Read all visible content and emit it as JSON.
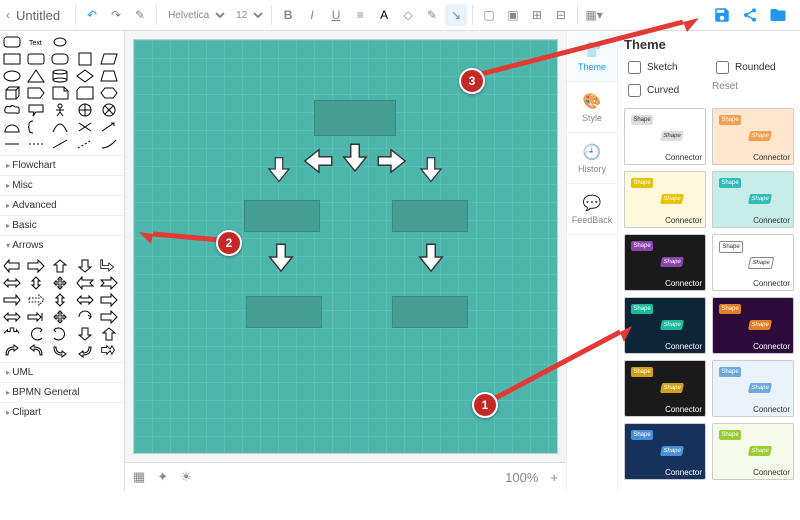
{
  "header": {
    "doc_title": "Untitled",
    "font_family": "Helvetica",
    "font_size": "12",
    "zoom": "100%"
  },
  "toolbar": {
    "undo": "↶",
    "redo": "↷",
    "paint": "⌂",
    "bold": "B",
    "italic": "I",
    "underline": "U",
    "save": "💾",
    "share": "⠪",
    "folder": "📁"
  },
  "left_panel": {
    "categories": [
      "Flowchart",
      "Misc",
      "Advanced",
      "Basic",
      "Arrows",
      "UML",
      "BPMN General",
      "Clipart"
    ]
  },
  "sidetabs": {
    "items": [
      {
        "label": "Theme",
        "icon": "👕"
      },
      {
        "label": "Style",
        "icon": "🎨"
      },
      {
        "label": "History",
        "icon": "🕘"
      },
      {
        "label": "FeedBack",
        "icon": "💬"
      }
    ]
  },
  "theme_panel": {
    "title": "Theme",
    "opt_sketch": "Sketch",
    "opt_rounded": "Rounded",
    "opt_curved": "Curved",
    "reset": "Reset",
    "shape_label": "Shape",
    "connector_label": "Connector"
  },
  "callouts": {
    "one": "1",
    "two": "2",
    "three": "3"
  },
  "footer": {
    "page": "▦",
    "layers": "✦",
    "sun": "☀",
    "zoom": "100%",
    "plus": "+"
  }
}
